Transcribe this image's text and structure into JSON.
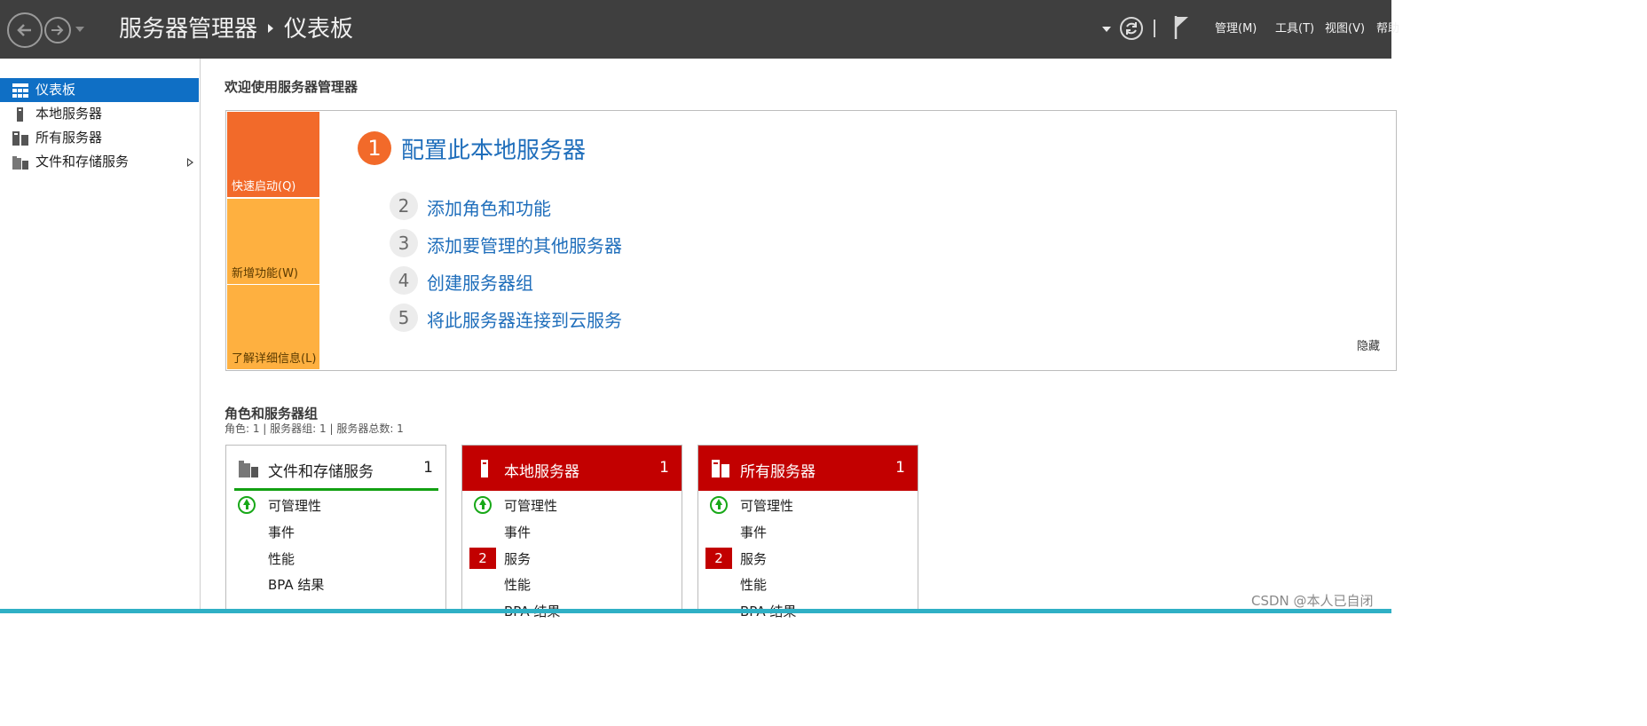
{
  "titlebar": {
    "breadcrumb_root": "服务器管理器",
    "breadcrumb_current": "仪表板",
    "menus": [
      "管理(M)",
      "工具(T)",
      "视图(V)",
      "帮助"
    ]
  },
  "sidebar": {
    "items": [
      {
        "label": "仪表板",
        "icon": "dashboard-icon"
      },
      {
        "label": "本地服务器",
        "icon": "server-icon"
      },
      {
        "label": "所有服务器",
        "icon": "servers-icon"
      },
      {
        "label": "文件和存储服务",
        "icon": "storage-icon"
      }
    ]
  },
  "welcome": {
    "title": "欢迎使用服务器管理器",
    "tiles": [
      "快速启动(Q)",
      "新增功能(W)",
      "了解详细信息(L)"
    ],
    "steps": [
      {
        "num": "1",
        "label": "配置此本地服务器"
      },
      {
        "num": "2",
        "label": "添加角色和功能"
      },
      {
        "num": "3",
        "label": "添加要管理的其他服务器"
      },
      {
        "num": "4",
        "label": "创建服务器组"
      },
      {
        "num": "5",
        "label": "将此服务器连接到云服务"
      }
    ],
    "hide": "隐藏"
  },
  "roles": {
    "title": "角色和服务器组",
    "summary": "角色: 1 | 服务器组: 1 | 服务器总数: 1",
    "cards": [
      {
        "title": "文件和存储服务",
        "count": "1",
        "rows": [
          "可管理性",
          "事件",
          "性能",
          "BPA 结果"
        ]
      },
      {
        "title": "本地服务器",
        "count": "1",
        "badge": "2",
        "rows": [
          "可管理性",
          "事件",
          "服务",
          "性能",
          "BPA 结果"
        ]
      },
      {
        "title": "所有服务器",
        "count": "1",
        "badge": "2",
        "rows": [
          "可管理性",
          "事件",
          "服务",
          "性能",
          "BPA 结果"
        ]
      }
    ]
  },
  "watermark": "CSDN @本人已自闭"
}
